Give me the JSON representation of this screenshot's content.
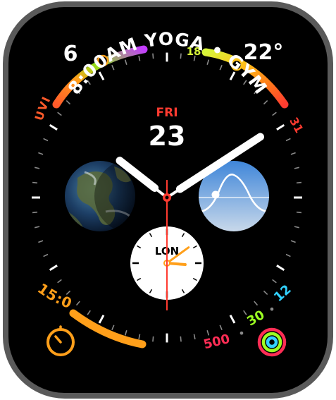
{
  "colors": {
    "case": "#5a5a5a",
    "screen": "#000000",
    "uv_grad": [
      "#ff5a2a",
      "#ff9f1a",
      "#8be21a",
      "#c33cff"
    ],
    "temp_grad": [
      "#d7f53a",
      "#ffc21a",
      "#ff7a1a",
      "#ff3b30"
    ],
    "timer": "#ff9f1a",
    "move": "#ff2d55",
    "exercise": "#9cff22",
    "stand": "#32d1ff",
    "date_day": "#ff3b30",
    "second_hand": "#ff3b30",
    "sky_top": "#3f86d9",
    "sky_bottom": "#c8d8ea"
  },
  "complications": {
    "uv": {
      "value": "6",
      "label": "UVI",
      "level": 0.55
    },
    "temperature": {
      "current": "22°",
      "low": "18",
      "high": "31",
      "level": 0.5
    },
    "calendar": {
      "event": "8:00AM YOGA • GYM"
    },
    "date": {
      "weekday": "FRI",
      "day": "23"
    },
    "timer": {
      "remaining": "15:00",
      "level": 1.0
    },
    "activity": {
      "move": "500",
      "exercise": "30",
      "stand": "12",
      "separator": "•"
    },
    "world_clock": {
      "city": "LON"
    },
    "earth": {
      "icon": "earth-icon"
    },
    "solar": {
      "icon": "sun-path-icon"
    }
  },
  "time": {
    "hour": 10,
    "minute": 9,
    "second": 30
  },
  "world_time": {
    "hour": 3,
    "minute": 9
  }
}
